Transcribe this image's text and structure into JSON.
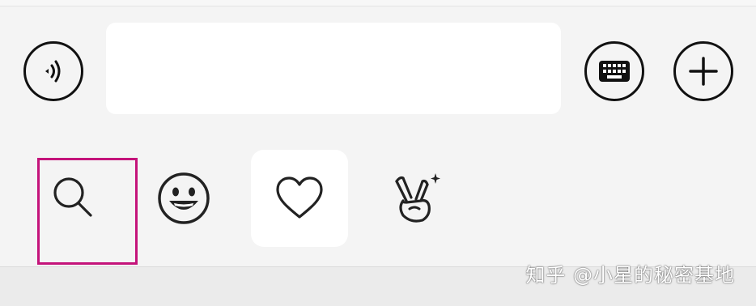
{
  "chat_input_bar": {
    "voice_icon": "voice-wave-icon",
    "message_text": "",
    "keyboard_icon": "keyboard-icon",
    "add_icon": "plus-icon"
  },
  "emoji_panel": {
    "tabs": [
      {
        "id": "search",
        "icon": "search-icon",
        "highlighted": true
      },
      {
        "id": "emoji",
        "icon": "grinning-face-icon"
      },
      {
        "id": "favorites",
        "icon": "heart-icon",
        "selected": true
      },
      {
        "id": "stickers",
        "icon": "victory-hand-sparkle-icon"
      }
    ],
    "highlight_color": "#c4137a"
  },
  "watermark": {
    "text": "知乎 @小星的秘密基地"
  }
}
